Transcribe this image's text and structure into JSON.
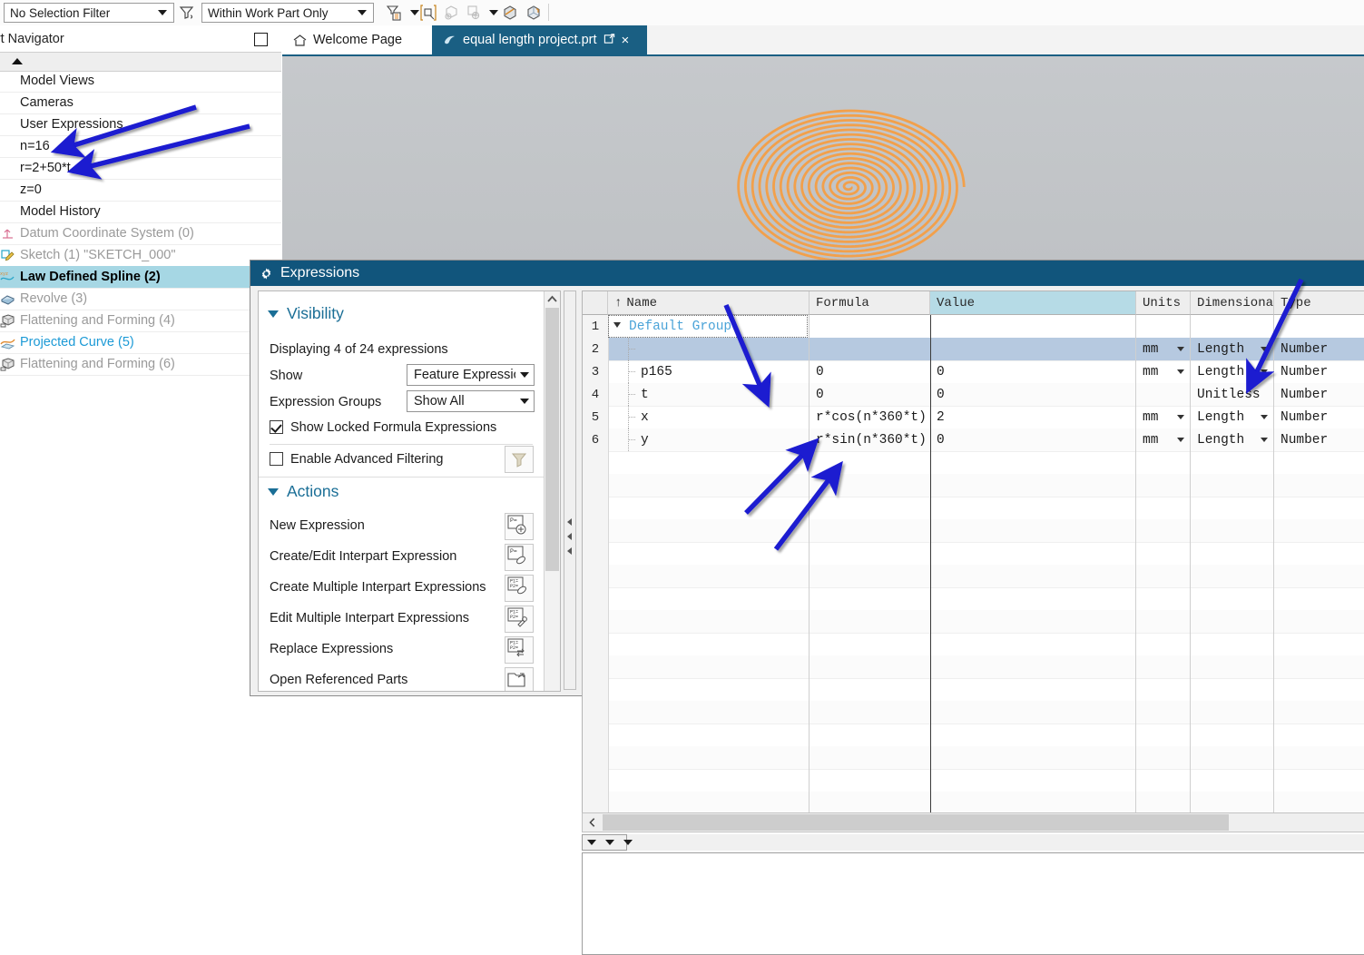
{
  "toolbar": {
    "selection_filter": {
      "value": "No Selection Filter"
    },
    "work_part_scope": {
      "value": "Within Work Part Only"
    },
    "icons": [
      "filter-icon",
      "selection-priority-icon",
      "snap-point-icon",
      "face-select-icon",
      "point-select-icon",
      "shaded-view-icon",
      "solid-body-icon"
    ]
  },
  "navigator": {
    "title": "Part Navigator",
    "items": [
      {
        "label": "Model Views",
        "style": "normal",
        "icon": ""
      },
      {
        "label": "Cameras",
        "style": "normal",
        "icon": ""
      },
      {
        "label": "User Expressions",
        "style": "normal",
        "icon": ""
      },
      {
        "label": "n=16",
        "style": "normal",
        "icon": ""
      },
      {
        "label": "r=2+50*t",
        "style": "normal",
        "icon": ""
      },
      {
        "label": "z=0",
        "style": "normal",
        "icon": ""
      },
      {
        "label": "Model History",
        "style": "normal",
        "icon": ""
      },
      {
        "label": "Datum Coordinate System (0)",
        "style": "dim",
        "icon": "datum-csys-icon"
      },
      {
        "label": "Sketch (1) \"SKETCH_000\"",
        "style": "dim",
        "icon": "sketch-icon"
      },
      {
        "label": "Law Defined Spline (2)",
        "style": "selected",
        "icon": "law-spline-icon"
      },
      {
        "label": "Revolve (3)",
        "style": "dim",
        "icon": "revolve-icon"
      },
      {
        "label": "Flattening and Forming (4)",
        "style": "dim",
        "icon": "flatten-form-icon"
      },
      {
        "label": "Projected Curve (5)",
        "style": "link",
        "icon": "projected-curve-icon"
      },
      {
        "label": "Flattening and Forming (6)",
        "style": "dim",
        "icon": "flatten-form-icon"
      }
    ]
  },
  "tabs": [
    {
      "label": "Welcome Page",
      "icon": "home-icon",
      "active": false,
      "closable": false
    },
    {
      "label": "equal length project.prt",
      "icon": "part-file-icon",
      "active": true,
      "closable": true,
      "close_glyph": "×",
      "detach_glyph": "↗"
    }
  ],
  "viewport": {
    "curve_color": "#f2a04b",
    "background_top": "#c6c9cc",
    "background_bottom": "#b0b3b6",
    "watermark": "cube-hexagon-logo",
    "watermark_color": "#8ecdf0",
    "spiral": {
      "turns": 16,
      "description": "archimedean-spiral"
    }
  },
  "dialog": {
    "title": "Expressions",
    "title_icon": "gear-icon",
    "visibility": {
      "heading": "Visibility",
      "displaying_text": "Displaying 4 of 24 expressions",
      "show_label": "Show",
      "show_value": "Feature Expressions",
      "groups_label": "Expression Groups",
      "groups_value": "Show All",
      "locked_checkbox_label": "Show Locked Formula Expressions",
      "locked_checked": true,
      "advanced_checkbox_label": "Enable Advanced Filtering",
      "advanced_checked": false,
      "filter_icon": "funnel-icon"
    },
    "actions": {
      "heading": "Actions",
      "items": [
        {
          "label": "New Expression",
          "icon": "new-expression-icon"
        },
        {
          "label": "Create/Edit Interpart Expression",
          "icon": "create-edit-interpart-icon"
        },
        {
          "label": "Create Multiple Interpart Expressions",
          "icon": "create-multiple-interpart-icon"
        },
        {
          "label": "Edit Multiple Interpart Expressions",
          "icon": "edit-multiple-interpart-icon"
        },
        {
          "label": "Replace Expressions",
          "icon": "replace-expressions-icon"
        },
        {
          "label": "Open Referenced Parts",
          "icon": "open-referenced-parts-icon"
        }
      ]
    },
    "table": {
      "sort_indicator": "↑",
      "columns": [
        "Name",
        "Formula",
        "Value",
        "Units",
        "Dimensionali",
        "Type"
      ],
      "value_column_highlight": "#b6dbe6",
      "rows": [
        {
          "num": "1",
          "name": "Default Group",
          "formula": "",
          "value": "",
          "units": "",
          "dim": "",
          "type": "",
          "group": true,
          "expander": "⌄",
          "selected": false
        },
        {
          "num": "2",
          "name": "",
          "formula": "",
          "value": "",
          "units": "mm",
          "dim": "Length",
          "type": "Number",
          "group": false,
          "selected": true
        },
        {
          "num": "3",
          "name": "p165",
          "formula": "0",
          "value": "0",
          "units": "mm",
          "dim": "Length",
          "type": "Number",
          "group": false,
          "selected": false
        },
        {
          "num": "4",
          "name": "t",
          "formula": "0",
          "value": "0",
          "units": "",
          "dim": "Unitless",
          "type": "Number",
          "group": false,
          "selected": false
        },
        {
          "num": "5",
          "name": "x",
          "formula": "r*cos(n*360*t)",
          "value": "2",
          "units": "mm",
          "dim": "Length",
          "type": "Number",
          "group": false,
          "selected": false
        },
        {
          "num": "6",
          "name": "y",
          "formula": "r*sin(n*360*t)",
          "value": "0",
          "units": "mm",
          "dim": "Length",
          "type": "Number",
          "group": false,
          "selected": false
        }
      ]
    }
  },
  "annotations": {
    "color": "#1a1ad0",
    "arrows": 5
  }
}
